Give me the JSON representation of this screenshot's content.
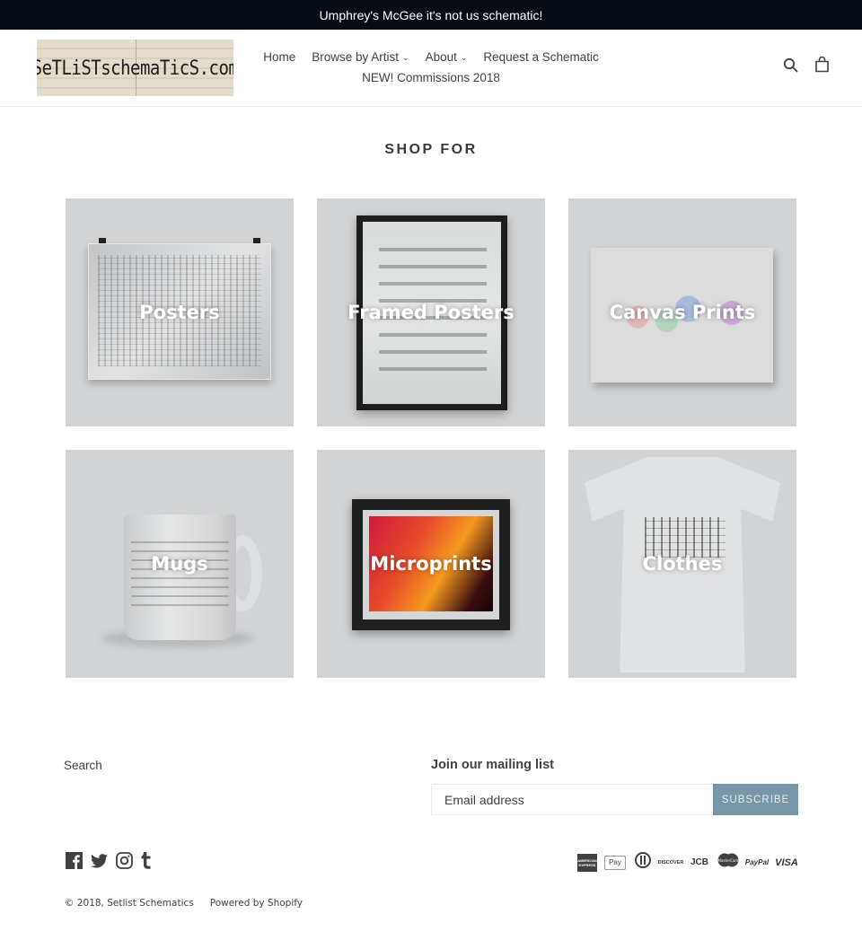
{
  "announcement": {
    "text": "Umphrey's McGee it's not us schematic!"
  },
  "header": {
    "logo_text": "SeTLiSTschemaTicS.com",
    "nav": [
      {
        "label": "Home",
        "has_dropdown": false
      },
      {
        "label": "Browse by Artist",
        "has_dropdown": true
      },
      {
        "label": "About",
        "has_dropdown": true
      },
      {
        "label": "Request a Schematic",
        "has_dropdown": false
      },
      {
        "label": "NEW! Commissions 2018",
        "has_dropdown": false
      }
    ],
    "dropdown_glyph": "⌄",
    "icons": [
      "search-icon",
      "cart-icon"
    ]
  },
  "main": {
    "section_title": "SHOP FOR",
    "collections": [
      {
        "title": "Posters"
      },
      {
        "title": "Framed Posters"
      },
      {
        "title": "Canvas Prints"
      },
      {
        "title": "Mugs"
      },
      {
        "title": "Microprints"
      },
      {
        "title": "Clothes"
      }
    ]
  },
  "footer": {
    "links": [
      "Search"
    ],
    "mailing": {
      "title": "Join our mailing list",
      "email_placeholder": "Email address",
      "subscribe_label": "SUBSCRIBE",
      "button_color": "#7796a8"
    },
    "social": [
      "facebook-icon",
      "twitter-icon",
      "instagram-icon",
      "tumblr-icon"
    ],
    "payments": [
      "American Express",
      "Apple Pay",
      "Diners Club",
      "Discover",
      "JCB",
      "Master",
      "PayPal",
      "VISA"
    ],
    "payment_labels": {
      "amex": "AMERICAN EXPRESS",
      "applepay": "Pay",
      "discover": "DISCOVER",
      "jcb": "JCB",
      "master": "MasterCard",
      "paypal": "PayPal",
      "visa": "VISA"
    },
    "copyright": "© 2018, Setlist Schematics",
    "powered_by": "Powered by Shopify"
  }
}
